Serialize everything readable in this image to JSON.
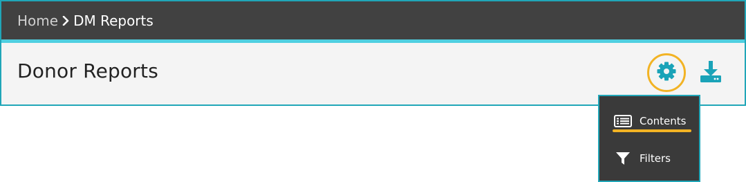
{
  "breadcrumb": {
    "home": "Home",
    "current": "DM Reports",
    "separator_icon": "chevron-right-icon"
  },
  "header": {
    "title": "Donor Reports",
    "settings_icon": "gear-icon",
    "download_icon": "download-icon"
  },
  "dropdown": {
    "items": [
      {
        "label": "Contents",
        "icon": "list-icon"
      },
      {
        "label": "Filters",
        "icon": "filter-icon"
      }
    ]
  },
  "colors": {
    "accent": "#20a6b8",
    "highlight": "#f2b324",
    "topbar": "#414141",
    "menu_bg": "#3a3a3a"
  }
}
